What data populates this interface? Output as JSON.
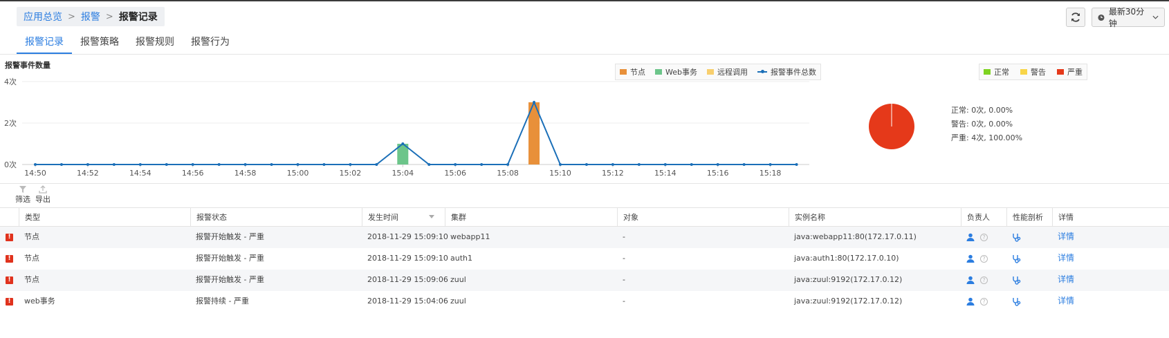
{
  "breadcrumb": {
    "items": [
      "应用总览",
      "报警"
    ],
    "current": "报警记录"
  },
  "toolbar": {
    "time_range": "最新30分钟"
  },
  "tabs": [
    "报警记录",
    "报警策略",
    "报警规则",
    "报警行为"
  ],
  "chart_data": [
    {
      "type": "bar",
      "title": "报警事件数量",
      "x": [
        "14:50",
        "14:51",
        "14:52",
        "14:53",
        "14:54",
        "14:55",
        "14:56",
        "14:57",
        "14:58",
        "14:59",
        "15:00",
        "15:01",
        "15:02",
        "15:03",
        "15:04",
        "15:05",
        "15:06",
        "15:07",
        "15:08",
        "15:09",
        "15:10",
        "15:11",
        "15:12",
        "15:13",
        "15:14",
        "15:15",
        "15:16",
        "15:17",
        "15:18",
        "15:19"
      ],
      "tick_labels": [
        "14:50",
        "14:52",
        "14:54",
        "14:56",
        "14:58",
        "15:00",
        "15:02",
        "15:04",
        "15:06",
        "15:08",
        "15:10",
        "15:12",
        "15:14",
        "15:16",
        "15:18"
      ],
      "y_tick_labels": [
        "4次",
        "2次",
        "0次"
      ],
      "ylim": [
        0,
        4
      ],
      "series": [
        {
          "name": "节点",
          "kind": "bar",
          "color": "#e8903a",
          "values": [
            0,
            0,
            0,
            0,
            0,
            0,
            0,
            0,
            0,
            0,
            0,
            0,
            0,
            0,
            0,
            0,
            0,
            0,
            0,
            3,
            0,
            0,
            0,
            0,
            0,
            0,
            0,
            0,
            0,
            0
          ]
        },
        {
          "name": "Web事务",
          "kind": "bar",
          "color": "#6cc58a",
          "values": [
            0,
            0,
            0,
            0,
            0,
            0,
            0,
            0,
            0,
            0,
            0,
            0,
            0,
            0,
            1,
            0,
            0,
            0,
            0,
            0,
            0,
            0,
            0,
            0,
            0,
            0,
            0,
            0,
            0,
            0
          ]
        },
        {
          "name": "远程调用",
          "kind": "bar",
          "color": "#f8cf6e",
          "values": [
            0,
            0,
            0,
            0,
            0,
            0,
            0,
            0,
            0,
            0,
            0,
            0,
            0,
            0,
            0,
            0,
            0,
            0,
            0,
            0,
            0,
            0,
            0,
            0,
            0,
            0,
            0,
            0,
            0,
            0
          ]
        },
        {
          "name": "报警事件总数",
          "kind": "line",
          "color": "#1b6fb8",
          "values": [
            0,
            0,
            0,
            0,
            0,
            0,
            0,
            0,
            0,
            0,
            0,
            0,
            0,
            0,
            1,
            0,
            0,
            0,
            0,
            3,
            0,
            0,
            0,
            0,
            0,
            0,
            0,
            0,
            0,
            0
          ]
        }
      ],
      "grid": true,
      "legend": "top-right"
    },
    {
      "type": "pie",
      "labels": [
        "正常",
        "警告",
        "严重"
      ],
      "colors": [
        "#7ed321",
        "#f8d548",
        "#e5391a"
      ],
      "values": [
        0,
        0,
        4
      ],
      "stats": [
        "正常: 0次, 0.00%",
        "警告: 0次, 0.00%",
        "严重: 4次, 100.00%"
      ],
      "legend": "top-right"
    }
  ],
  "tools": {
    "filter": "筛选",
    "export": "导出"
  },
  "table": {
    "columns": [
      "类型",
      "报警状态",
      "发生时间",
      "集群",
      "对象",
      "实例名称",
      "负责人",
      "性能剖析",
      "详情"
    ],
    "rows": [
      {
        "type": "节点",
        "status": "报警开始触发 - 严重",
        "time": "2018-11-29 15:09:10",
        "cluster": "webapp11",
        "object": "-",
        "instance": "java:webapp11:80(172.17.0.11)",
        "detail": "详情"
      },
      {
        "type": "节点",
        "status": "报警开始触发 - 严重",
        "time": "2018-11-29 15:09:10",
        "cluster": "auth1",
        "object": "-",
        "instance": "java:auth1:80(172.17.0.10)",
        "detail": "详情"
      },
      {
        "type": "节点",
        "status": "报警开始触发 - 严重",
        "time": "2018-11-29 15:09:06",
        "cluster": "zuul",
        "object": "-",
        "instance": "java:zuul:9192(172.17.0.12)",
        "detail": "详情"
      },
      {
        "type": "web事务",
        "status": "报警持续 - 严重",
        "time": "2018-11-29 15:04:06",
        "cluster": "zuul",
        "object": "-",
        "instance": "java:zuul:9192(172.17.0.12)",
        "detail": "详情"
      }
    ]
  }
}
